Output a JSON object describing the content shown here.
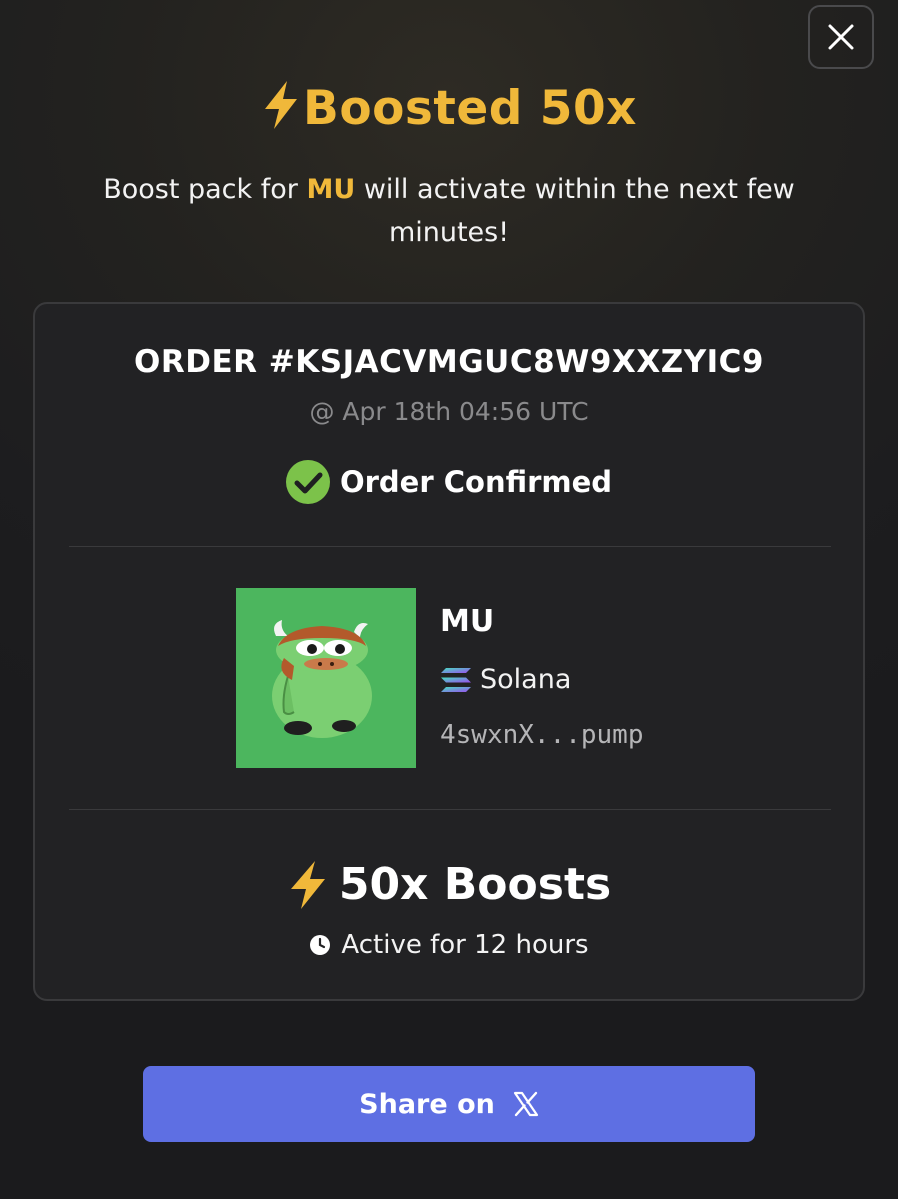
{
  "header": {
    "title": "Boosted 50x",
    "subtitle_before": "Boost pack for ",
    "subtitle_token": "MU",
    "subtitle_after": " will activate within the next few minutes!",
    "accent_color": "#f0b83a",
    "close_icon": "close-icon"
  },
  "order": {
    "id_label": "ORDER #KSJACVMGUC8W9XXZYIC9",
    "time": "@ Apr 18th 04:56 UTC",
    "status": "Order Confirmed",
    "status_color": "#7cc24a"
  },
  "token": {
    "name": "MU",
    "chain": "Solana",
    "chain_icon": "solana-icon",
    "address": "4swxnX...pump",
    "image": "token-avatar-green-frog-cow"
  },
  "boost": {
    "label": "50x Boosts",
    "duration": "Active for 12 hours",
    "bolt_icon": "lightning-icon",
    "clock_icon": "clock-icon"
  },
  "share": {
    "label": "Share on",
    "icon": "x-logo-icon",
    "button_color": "#5e6fe3"
  }
}
